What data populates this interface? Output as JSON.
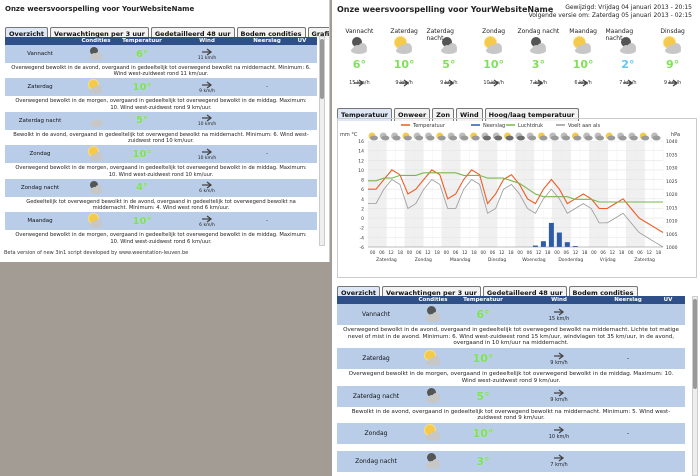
{
  "left": {
    "title": "Onze weersvoorspelling voor YourWebsiteName",
    "tabs": [
      "Overzicht",
      "Verwachtingen per 3 uur",
      "Gedetailleerd 48 uur",
      "Bodem condities",
      "Grafieken"
    ],
    "headers": [
      "Condities",
      "Temperatuur",
      "Wind",
      "Neerslag",
      "UV"
    ],
    "rows": [
      {
        "label": "Vannacht",
        "icon": "night-cloud-icon",
        "temp": "6°",
        "wind": "11 km/h",
        "rain": "",
        "desc": "Overwegend bewolkt in de avond, overgaand in gedeeltelijk tot overwegend bewolkt na middernacht. Minimum: 6. Wind west-zuidwest rond 11 km/uur."
      },
      {
        "label": "Zaterdag",
        "icon": "sun-cloud-icon",
        "temp": "10°",
        "wind": "9 km/h",
        "rain": "-",
        "desc": "Overwegend bewolkt in de morgen, overgaand in gedeeltelijk tot overwegend bewolkt in de middag. Maximum: 10. Wind west-zuidwest rond 9 km/uur."
      },
      {
        "label": "Zaterdag nacht",
        "icon": "cloud-icon",
        "temp": "5°",
        "wind": "10 km/h",
        "rain": "",
        "desc": "Bewolkt in de avond, overgaand in gedeeltelijk tot overwegend bewolkt na middernacht. Minimum: 6. Wind west-zuidwest rond 10 km/uur."
      },
      {
        "label": "Zondag",
        "icon": "sun-cloud-icon",
        "temp": "10°",
        "wind": "10 km/h",
        "rain": "-",
        "desc": "Overwegend bewolkt in de morgen, overgaand in gedeeltelijk tot overwegend bewolkt in de middag. Maximum: 10. Wind west-zuidwest rond 10 km/uur."
      },
      {
        "label": "Zondag nacht",
        "icon": "night-cloud-icon",
        "temp": "4°",
        "wind": "6 km/h",
        "rain": "",
        "desc": "Gedeeltelijk tot overwegend bewolkt in de avond, overgaand in gedeeltelijk tot overwegend bewolkt na middernacht. Minimum: 4. Wind west rond 6 km/uur."
      },
      {
        "label": "Maandag",
        "icon": "sun-cloud-icon",
        "temp": "10°",
        "wind": "6 km/h",
        "rain": "-",
        "desc": "Overwegend bewolkt in de morgen, overgaand in gedeeltelijk tot overwegend bewolkt in de middag. Maximum: 10. Wind west-zuidwest rond 6 km/uur."
      }
    ],
    "credit": "Beta version of new 3in1 script developed by www.weerstation-leuven.be"
  },
  "right": {
    "title": "Onze weersvoorspelling voor YourWebsiteName",
    "updated": "Gewijzigd: Vrijdag 04 januari 2013 - 20:15",
    "next": "Volgende versie om: Zaterdag 05 januari 2013 - 02:15",
    "days": [
      {
        "name": "Vannacht",
        "icon": "night-cloud-icon",
        "temp": "6°",
        "wind": "15 km/h",
        "cold": false
      },
      {
        "name": "Zaterdag",
        "icon": "sun-cloud-icon",
        "temp": "10°",
        "wind": "9 km/h",
        "cold": false
      },
      {
        "name": "Zaterdag nacht",
        "icon": "night-cloud-icon",
        "temp": "5°",
        "wind": "9 km/h",
        "cold": false
      },
      {
        "name": "Zondag",
        "icon": "sun-cloud-icon",
        "temp": "10°",
        "wind": "10 km/h",
        "cold": false
      },
      {
        "name": "Zondag nacht",
        "icon": "night-cloud-icon",
        "temp": "3°",
        "wind": "7 km/h",
        "cold": false
      },
      {
        "name": "Maandag",
        "icon": "sun-cloud-icon",
        "temp": "10°",
        "wind": "6 km/h",
        "cold": false
      },
      {
        "name": "Maandag nacht",
        "icon": "night-cloud-icon",
        "temp": "2°",
        "wind": "7 km/h",
        "cold": true
      },
      {
        "name": "Dinsdag",
        "icon": "sun-cloud-icon",
        "temp": "9°",
        "wind": "9 km/h",
        "cold": false
      }
    ],
    "chart_tabs": [
      "Temperatuur",
      "Onweer",
      "Zon",
      "Wind",
      "Hoog/laag temperatuur"
    ],
    "bottom_tabs": [
      "Overzicht",
      "Verwachtingen per 3 uur",
      "Gedetailleerd 48 uur",
      "Bodem condities"
    ],
    "headers": [
      "Condities",
      "Temperatuur",
      "Wind",
      "Neerslag",
      "UV"
    ],
    "rows": [
      {
        "label": "Vannacht",
        "icon": "night-cloud-icon",
        "temp": "6°",
        "wind": "15 km/h",
        "rain": "",
        "desc": "Overwegend bewolkt in de avond, overgaand in gedeeltelijk tot overwegend bewolkt na middernacht. Lichte tot matige nevel of mist in de avond. Minimum: 6. Wind west-zuidwest rond 15 km/uur, windvlagen tot 35 km/uur, in de avond, overgaand in 10 km/uur na middernacht."
      },
      {
        "label": "Zaterdag",
        "icon": "sun-cloud-icon",
        "temp": "10°",
        "wind": "9 km/h",
        "rain": "-",
        "desc": "Overwegend bewolkt in de morgen, overgaand in gedeeltelijk tot overwegend bewolkt in de middag. Maximum: 10. Wind west-zuidwest rond 9 km/uur."
      },
      {
        "label": "Zaterdag nacht",
        "icon": "night-cloud-icon",
        "temp": "5°",
        "wind": "9 km/h",
        "rain": "",
        "desc": "Bewolkt in de avond, overgaand in gedeeltelijk tot overwegend bewolkt na middernacht. Minimum: 5. Wind west-zuidwest rond 9 km/uur."
      },
      {
        "label": "Zondag",
        "icon": "sun-cloud-icon",
        "temp": "10°",
        "wind": "10 km/h",
        "rain": "-",
        "desc": ""
      },
      {
        "label": "Zondag nacht",
        "icon": "night-cloud-icon",
        "temp": "3°",
        "wind": "7 km/h",
        "rain": "",
        "desc": ""
      }
    ]
  },
  "chart_data": {
    "type": "line",
    "legend": [
      "Temperatuur",
      "Neerslag",
      "Luchtdruk",
      "Voelt aan als"
    ],
    "y_left_label": "mm °C",
    "y_right_label": "hPa",
    "y_left_ticks": [
      "16",
      "14",
      "12",
      "10",
      "8",
      "6",
      "4",
      "2",
      "0",
      "-2",
      "-4",
      "-6"
    ],
    "y_right_ticks": [
      "1040",
      "1035",
      "1030",
      "1025",
      "1020",
      "1015",
      "1010",
      "1005",
      "1000"
    ],
    "x_hour_ticks": [
      "00",
      "06",
      "12",
      "18",
      "00",
      "06",
      "12",
      "18",
      "00",
      "06",
      "12",
      "18",
      "00",
      "06",
      "12",
      "18",
      "00",
      "06",
      "12",
      "18",
      "00",
      "06",
      "12",
      "18",
      "00",
      "06",
      "12",
      "18",
      "00",
      "06",
      "12",
      "18"
    ],
    "x_day_ticks": [
      "Zaterdag",
      "Zondag",
      "Maandag",
      "Dinsdag",
      "Woensdag",
      "Donderdag",
      "Vrijdag",
      "Zaterdag"
    ],
    "ylim": [
      -6,
      16
    ],
    "series": [
      {
        "name": "Temperatuur",
        "color": "#ef5b22",
        "values": [
          6,
          6,
          8,
          10,
          9,
          5,
          6,
          8,
          10,
          9,
          4,
          5,
          8,
          10,
          9,
          3,
          5,
          8,
          9,
          7,
          4,
          3,
          6,
          8,
          6,
          3,
          4,
          5,
          4,
          2,
          2,
          3,
          4,
          2,
          0,
          -1,
          -2,
          -3
        ]
      },
      {
        "name": "Luchtdruk",
        "color": "#79b74a",
        "values": [
          1025,
          1025,
          1026,
          1026,
          1027,
          1027,
          1027,
          1028,
          1028,
          1028,
          1028,
          1028,
          1027,
          1027,
          1027,
          1026,
          1026,
          1026,
          1025,
          1024,
          1022,
          1020,
          1019,
          1019,
          1019,
          1019,
          1018,
          1018,
          1018,
          1017,
          1017,
          1017,
          1017,
          1017,
          1017,
          1017,
          1017,
          1017
        ]
      },
      {
        "name": "Voelt aan als",
        "color": "#999999",
        "values": [
          3,
          3,
          6,
          8,
          7,
          2,
          3,
          6,
          8,
          7,
          2,
          2,
          6,
          8,
          7,
          1,
          2,
          6,
          7,
          5,
          2,
          1,
          4,
          6,
          4,
          1,
          2,
          3,
          2,
          -1,
          -1,
          0,
          1,
          -1,
          -3,
          -4,
          -5,
          -6
        ]
      },
      {
        "name": "Neerslag",
        "color": "#2e5aa8",
        "values": [
          0,
          0,
          0,
          0,
          0,
          0,
          0,
          0,
          0,
          0,
          0,
          0,
          0,
          0,
          0,
          0,
          0,
          0,
          0,
          0,
          0,
          0.3,
          1.2,
          5,
          3,
          1,
          0.2,
          0,
          0,
          0,
          0,
          0,
          0,
          0,
          0,
          0,
          0,
          0
        ]
      }
    ]
  },
  "colors": {
    "header": "#2f4f88",
    "row": "#b9cde9",
    "temp_warm": "#7fe05a",
    "temp_cold": "#5fc6ef"
  }
}
